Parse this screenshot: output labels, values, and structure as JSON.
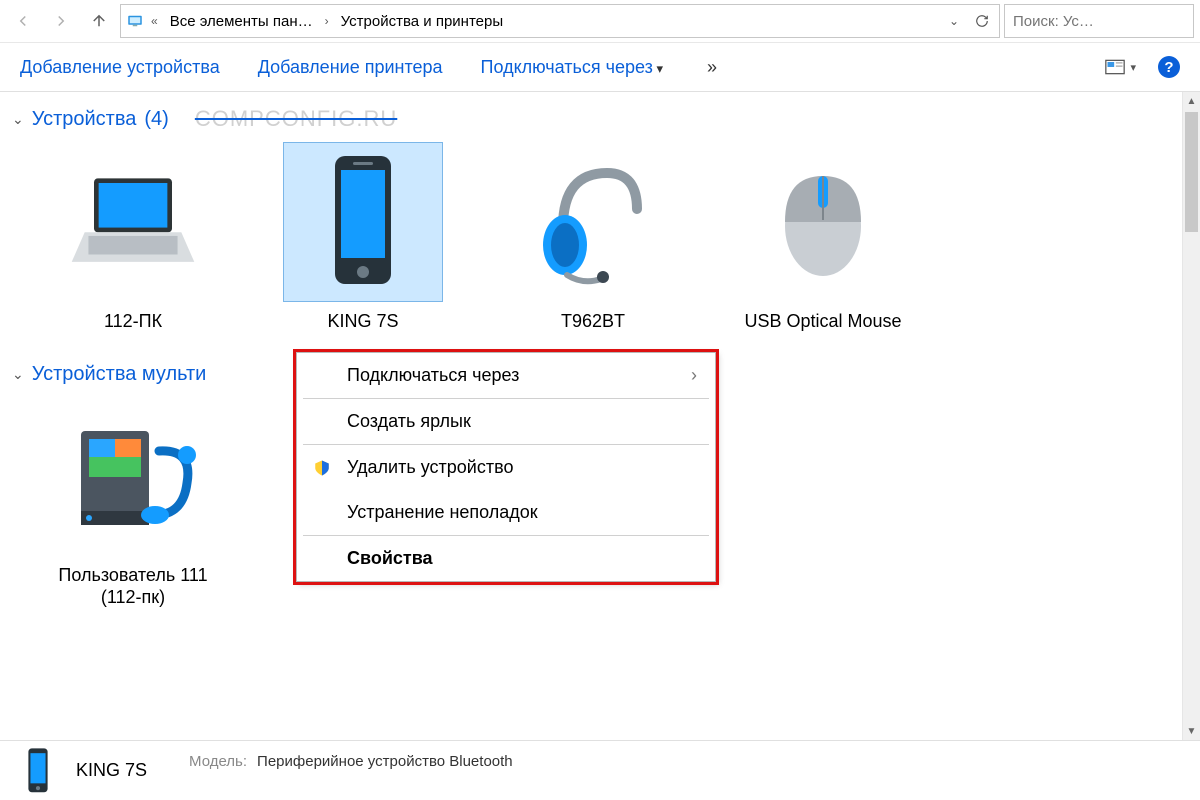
{
  "breadcrumb": {
    "prefix_glyph": "«",
    "seg1": "Все элементы пан…",
    "seg2": "Устройства и принтеры"
  },
  "search": {
    "placeholder": "Поиск: Ус…"
  },
  "toolbar": {
    "add_device": "Добавление устройства",
    "add_printer": "Добавление принтера",
    "connect_via": "Подключаться через",
    "overflow": "»"
  },
  "watermark": "COMPCONFIG.RU",
  "sections": {
    "devices": {
      "title": "Устройства",
      "count": "(4)"
    },
    "multimedia": {
      "title": "Устройства мульти"
    }
  },
  "devices": [
    {
      "label": "112-ПК"
    },
    {
      "label": "KING 7S"
    },
    {
      "label": "T962BT"
    },
    {
      "label": "USB Optical Mouse"
    }
  ],
  "multimedia": [
    {
      "label": "Пользователь 111 (112-пк)"
    }
  ],
  "context_menu": {
    "connect_via": "Подключаться через",
    "create_shortcut": "Создать ярлык",
    "remove_device": "Удалить устройство",
    "troubleshoot": "Устранение неполадок",
    "properties": "Свойства"
  },
  "details": {
    "title": "KING 7S",
    "model_key": "Модель:",
    "model_val": "Периферийное устройство Bluetooth"
  }
}
